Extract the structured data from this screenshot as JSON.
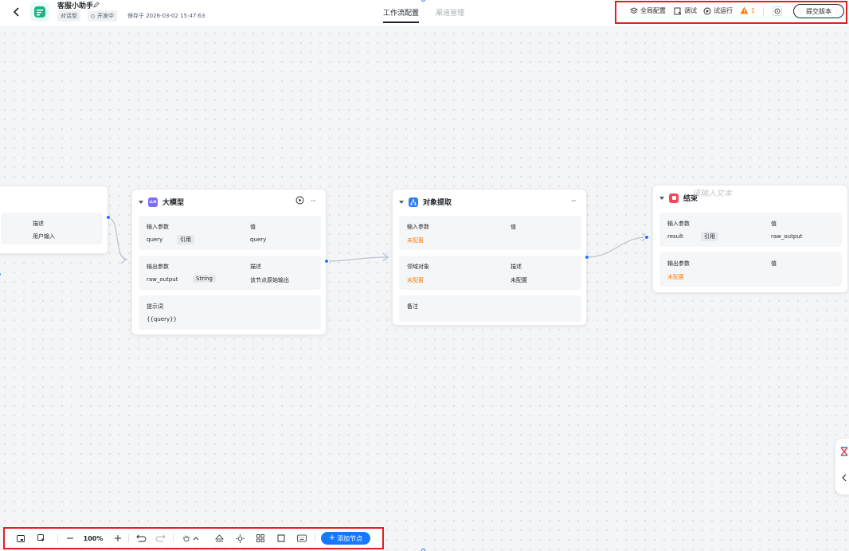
{
  "header": {
    "app_name": "客服小助手",
    "type_badge": "对话型",
    "status": "开发中",
    "save_time": "保存于 2026-03-02 15:47:63",
    "tabs": [
      {
        "label": "工作流配置",
        "active": true
      },
      {
        "label": "渠道管理",
        "active": false
      }
    ],
    "toolbar": {
      "global_config": "全局配置",
      "debug": "调试",
      "trial_run": "试运行",
      "warning_count": "1",
      "submit_version": "提交版本"
    }
  },
  "nodes": {
    "start": {
      "col_desc": "描述",
      "desc_value": "用户输入"
    },
    "llm": {
      "title": "大模型",
      "icon_text": "LLM",
      "input": {
        "col_param": "输入参数",
        "col_value": "值",
        "param": "query",
        "tag": "引用",
        "value": "query"
      },
      "output": {
        "col_param": "输出参数",
        "col_desc": "描述",
        "param": "raw_output",
        "type": "String",
        "desc": "该节点原始输出"
      },
      "prompt": {
        "label": "提示词",
        "value": "{{query}}"
      }
    },
    "extract": {
      "title": "对象提取",
      "input": {
        "col_param": "输入参数",
        "col_value": "值",
        "unset": "未配置"
      },
      "domain": {
        "col_domain": "领域对象",
        "col_desc": "描述",
        "unset_left": "未配置",
        "unset_right": "未配置"
      },
      "remark": {
        "label": "备注"
      }
    },
    "end": {
      "title": "结束",
      "placeholder": "请输入文本",
      "input": {
        "col_param": "输入参数",
        "col_value": "值",
        "param": "result",
        "tag": "引用",
        "value": "raw_output"
      },
      "output": {
        "col_param": "输出参数",
        "col_value": "值",
        "unset": "未配置"
      }
    }
  },
  "bottom_toolbar": {
    "zoom": "100%",
    "add_node": "添加节点"
  },
  "colors": {
    "accent": "#1677ff",
    "warning": "#ff7d00",
    "highlight_box": "#e02020",
    "llm_icon": "#7b6cf6",
    "extract_icon": "#2f7cf6",
    "end_icon": "#f5455c",
    "logo": "#12b886"
  },
  "icons": [
    "back-icon",
    "edit-icon",
    "layers-icon",
    "debug-icon",
    "play-icon",
    "warning-icon",
    "history-icon",
    "more-icon",
    "run-node-icon",
    "minimap-icon",
    "zoom-out-icon",
    "zoom-in-icon",
    "undo-icon",
    "redo-icon",
    "hand-icon",
    "pointer-icon",
    "eraser-icon",
    "locate-icon",
    "grid-icon",
    "frame-icon",
    "keyboard-icon"
  ]
}
